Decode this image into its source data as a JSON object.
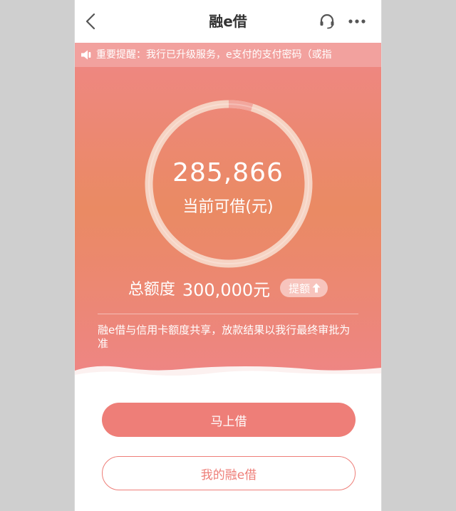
{
  "header": {
    "title": "融e借",
    "back_icon": "chevron-left-icon",
    "service_icon": "headset-icon",
    "more_icon": "more-dots-icon"
  },
  "notice": {
    "icon": "speaker-icon",
    "text": "重要提醒：我行已升级服务，e支付的支付密码（或指"
  },
  "loan": {
    "available_amount": "285,866",
    "available_label": "当前可借(元)",
    "total_label": "总额度",
    "total_value": "300,000元",
    "used_fraction": 0.047,
    "raise_label": "提额",
    "raise_icon": "arrow-up-icon",
    "disclaimer": "融e借与信用卡额度共享，放款结果以我行最终审批为准"
  },
  "actions": {
    "borrow_now_label": "马上借",
    "my_loans_label": "我的融e借"
  },
  "colors": {
    "accent": "#ee7e78",
    "notice_bg": "#f2a19e",
    "hero_top": "#ee8780",
    "hero_mid": "#ea8a63"
  }
}
